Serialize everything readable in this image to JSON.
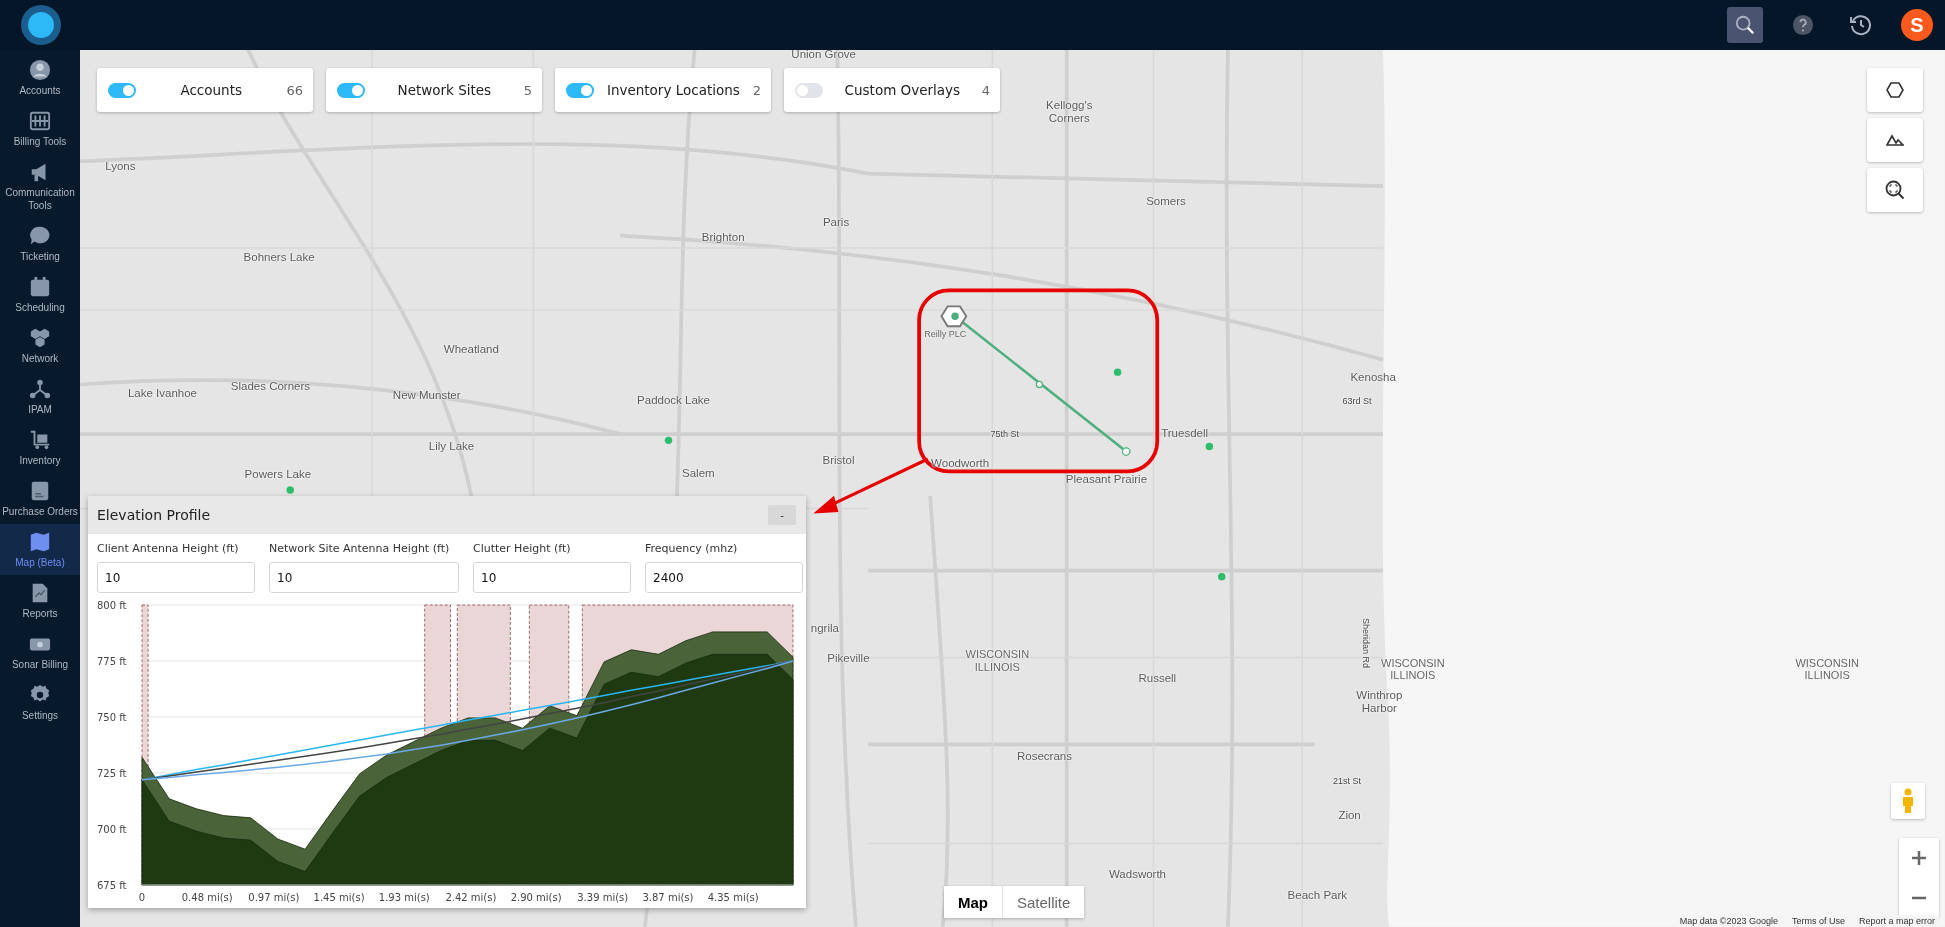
{
  "topbar": {
    "avatar_letter": "S"
  },
  "sidebar": {
    "items": [
      {
        "label": "Accounts",
        "selected": false
      },
      {
        "label": "Billing Tools",
        "selected": false
      },
      {
        "label": "Communication Tools",
        "selected": false
      },
      {
        "label": "Ticketing",
        "selected": false
      },
      {
        "label": "Scheduling",
        "selected": false
      },
      {
        "label": "Network",
        "selected": false
      },
      {
        "label": "IPAM",
        "selected": false
      },
      {
        "label": "Inventory",
        "selected": false
      },
      {
        "label": "Purchase Orders",
        "selected": false
      },
      {
        "label": "Map (Beta)",
        "selected": true
      },
      {
        "label": "Reports",
        "selected": false
      },
      {
        "label": "Sonar Billing",
        "selected": false
      },
      {
        "label": "Settings",
        "selected": false
      }
    ]
  },
  "layer_toggles": [
    {
      "label": "Accounts",
      "count": "66",
      "on": true
    },
    {
      "label": "Network Sites",
      "count": "5",
      "on": true
    },
    {
      "label": "Inventory Locations",
      "count": "2",
      "on": true
    },
    {
      "label": "Custom Overlays",
      "count": "4",
      "on": false
    }
  ],
  "map": {
    "labels": [
      "Union Grove",
      "Kellogg's Corners",
      "Lyons",
      "Somers",
      "Paris",
      "Brighton",
      "Bohners Lake",
      "Wheatland",
      "Kenosha",
      "Slades Corners",
      "Lake Ivanhoe",
      "New Munster",
      "Paddock Lake",
      "63rd St",
      "75th St",
      "Truesdell",
      "Lily Lake",
      "Bristol",
      "Woodworth",
      "Salem",
      "Powers Lake",
      "Pleasant Prairie",
      "ngrila",
      "Pikeville",
      "WISCONSIN ILLINOIS",
      "Russell",
      "WISCONSIN ILLINOIS",
      "WISCONSIN ILLINOIS",
      "Sheridan Rd",
      "Winthrop Harbor",
      "Rosecrans",
      "21st St",
      "Zion",
      "Wadsworth",
      "Beach Park"
    ],
    "site_label": "Reilly PLC",
    "type_buttons": [
      {
        "label": "Map",
        "selected": true
      },
      {
        "label": "Satellite",
        "selected": false
      }
    ],
    "attribution": [
      "Map data ©2023 Google",
      "Terms of Use",
      "Report a map error"
    ]
  },
  "elevation_panel": {
    "title": "Elevation Profile",
    "collapse_label": "-",
    "fields": [
      {
        "label": "Client Antenna Height (ft)",
        "value": "10"
      },
      {
        "label": "Network Site Antenna Height (ft)",
        "value": "10"
      },
      {
        "label": "Clutter Height (ft)",
        "value": "10"
      },
      {
        "label": "Frequency (mhz)",
        "value": "2400"
      }
    ],
    "chart_data": {
      "type": "area",
      "x": [
        0,
        0.2,
        0.4,
        0.6,
        0.8,
        1.0,
        1.2,
        1.4,
        1.6,
        1.8,
        2.0,
        2.2,
        2.4,
        2.6,
        2.8,
        3.0,
        3.2,
        3.4,
        3.6,
        3.8,
        4.0,
        4.2,
        4.4,
        4.6,
        4.79
      ],
      "xlim": [
        0,
        4.79
      ],
      "ylim": [
        675,
        800
      ],
      "xticks": [
        {
          "value": 0,
          "label": "0"
        },
        {
          "value": 0.48,
          "label": "0.48 mi(s)"
        },
        {
          "value": 0.97,
          "label": "0.97 mi(s)"
        },
        {
          "value": 1.45,
          "label": "1.45 mi(s)"
        },
        {
          "value": 1.93,
          "label": "1.93 mi(s)"
        },
        {
          "value": 2.42,
          "label": "2.42 mi(s)"
        },
        {
          "value": 2.9,
          "label": "2.90 mi(s)"
        },
        {
          "value": 3.39,
          "label": "3.39 mi(s)"
        },
        {
          "value": 3.87,
          "label": "3.87 mi(s)"
        },
        {
          "value": 4.35,
          "label": "4.35 mi(s)"
        }
      ],
      "yticks": [
        {
          "value": 800,
          "label": "800 ft"
        },
        {
          "value": 775,
          "label": "775 ft"
        },
        {
          "value": 750,
          "label": "750 ft"
        },
        {
          "value": 725,
          "label": "725 ft"
        },
        {
          "value": 700,
          "label": "700 ft"
        },
        {
          "value": 675,
          "label": "675 ft"
        }
      ],
      "series": [
        {
          "type": "area",
          "color": "#4a6338",
          "values": [
            732,
            713.5,
            709,
            706,
            705,
            695.5,
            691,
            708,
            724.6,
            733,
            739,
            745,
            749.6,
            749.6,
            745,
            755,
            750.6,
            774.6,
            780,
            778,
            784,
            788,
            788,
            788,
            776.7
          ]
        },
        {
          "type": "area",
          "color": "#1f3a10",
          "values": [
            722,
            703.5,
            699,
            696,
            695,
            685.5,
            681,
            698,
            714.6,
            723,
            729,
            735,
            739.6,
            739.6,
            735,
            745,
            740.6,
            764.6,
            770,
            768,
            774,
            778,
            778,
            778,
            766.7
          ]
        },
        {
          "type": "line",
          "color": "#29b6f6",
          "values": [
            722,
            724.2,
            726.5,
            728.6,
            730.9,
            733.1,
            735.3,
            737.5,
            739.7,
            741.9,
            744.2,
            746.3,
            748.6,
            750.8,
            753.0,
            755.2,
            757.4,
            759.6,
            761.9,
            764.0,
            766.3,
            768.5,
            770.7,
            772.9,
            775
          ]
        },
        {
          "type": "line",
          "color": "#444444",
          "values": [
            722,
            723.7,
            725.5,
            727.1,
            728.9,
            730.7,
            732.5,
            734.3,
            736.2,
            738.2,
            740.3,
            742.3,
            744.6,
            746.8,
            749.1,
            751.5,
            753.9,
            756.4,
            759.1,
            761.6,
            764.3,
            767.0,
            769.7,
            772.4,
            775
          ]
        },
        {
          "type": "line",
          "color": "#6aa9e8",
          "values": [
            722,
            723.0,
            724.2,
            725.2,
            726.4,
            727.6,
            728.9,
            730.4,
            731.9,
            733.5,
            735.5,
            737.4,
            739.6,
            741.9,
            744.3,
            746.9,
            749.6,
            752.5,
            755.5,
            758.6,
            761.9,
            765.2,
            768.5,
            771.7,
            775
          ]
        }
      ],
      "grid": true,
      "bands": [
        {
          "axis": "x",
          "from": 0,
          "to": 0.045
        },
        {
          "axis": "x",
          "from": 2.08,
          "to": 2.27
        },
        {
          "axis": "x",
          "from": 2.32,
          "to": 2.71
        },
        {
          "axis": "x",
          "from": 2.85,
          "to": 3.14
        },
        {
          "axis": "x",
          "from": 3.24,
          "to": 4.79
        }
      ]
    }
  }
}
